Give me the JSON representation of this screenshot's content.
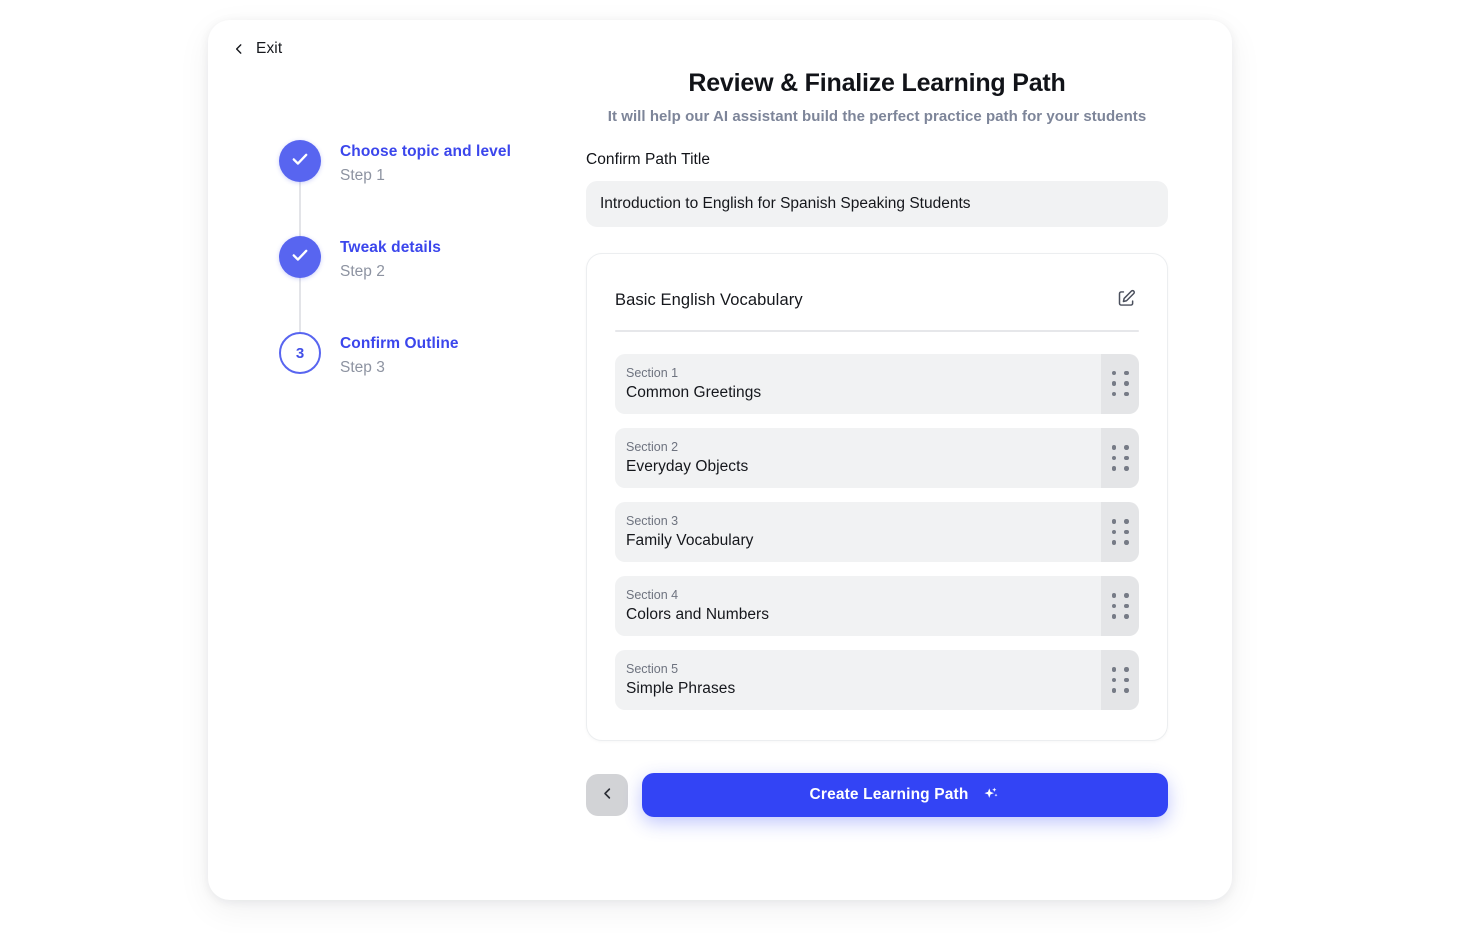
{
  "nav": {
    "exit_label": "Exit",
    "exit_icon": "chevron-left-icon"
  },
  "stepper": {
    "steps": [
      {
        "title": "Choose topic and level",
        "sub": "Step 1",
        "state": "done",
        "number": "1",
        "icon": "check-icon"
      },
      {
        "title": "Tweak details",
        "sub": "Step 2",
        "state": "done",
        "number": "2",
        "icon": "check-icon"
      },
      {
        "title": "Confirm Outline",
        "sub": "Step 3",
        "state": "current",
        "number": "3",
        "icon": ""
      }
    ]
  },
  "header": {
    "title": "Review & Finalize Learning Path",
    "subtitle": "It will help our AI assistant build the perfect practice path for your students"
  },
  "path_title_field": {
    "label": "Confirm Path Title",
    "value": "Introduction to English for Spanish Speaking Students",
    "placeholder": "Enter path title"
  },
  "outline": {
    "title": "Basic English Vocabulary",
    "edit_icon": "edit-pencil-icon",
    "sections": [
      {
        "kicker": "Section 1",
        "name": "Common Greetings",
        "handle_icon": "drag-handle-icon"
      },
      {
        "kicker": "Section 2",
        "name": "Everyday Objects",
        "handle_icon": "drag-handle-icon"
      },
      {
        "kicker": "Section 3",
        "name": "Family Vocabulary",
        "handle_icon": "drag-handle-icon"
      },
      {
        "kicker": "Section 4",
        "name": "Colors and Numbers",
        "handle_icon": "drag-handle-icon"
      },
      {
        "kicker": "Section 5",
        "name": "Simple Phrases",
        "handle_icon": "drag-handle-icon"
      }
    ]
  },
  "actions": {
    "back_icon": "chevron-left-icon",
    "create_label": "Create Learning Path",
    "create_icon": "sparkles-icon"
  },
  "colors": {
    "accent_blue": "#3344f5",
    "step_blue": "#5865f0",
    "step_text_blue": "#3b46ec",
    "subtitle_gray": "#7d8599",
    "field_gray": "#f1f2f3",
    "handle_gray": "#e4e5e7",
    "back_gray": "#d2d3d6"
  }
}
